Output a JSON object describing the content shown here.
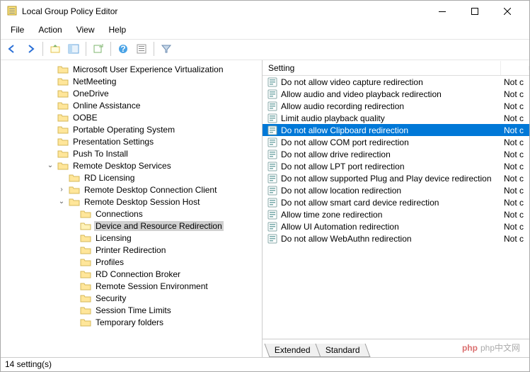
{
  "window": {
    "title": "Local Group Policy Editor"
  },
  "menu": {
    "file": "File",
    "action": "Action",
    "view": "View",
    "help": "Help"
  },
  "tree": [
    {
      "indent": 4,
      "exp": "",
      "label": "Microsoft User Experience Virtualization"
    },
    {
      "indent": 4,
      "exp": "",
      "label": "NetMeeting"
    },
    {
      "indent": 4,
      "exp": "",
      "label": "OneDrive"
    },
    {
      "indent": 4,
      "exp": "",
      "label": "Online Assistance"
    },
    {
      "indent": 4,
      "exp": "",
      "label": "OOBE"
    },
    {
      "indent": 4,
      "exp": "",
      "label": "Portable Operating System"
    },
    {
      "indent": 4,
      "exp": "",
      "label": "Presentation Settings"
    },
    {
      "indent": 4,
      "exp": "",
      "label": "Push To Install"
    },
    {
      "indent": 4,
      "exp": "⌄",
      "label": "Remote Desktop Services"
    },
    {
      "indent": 5,
      "exp": "",
      "label": "RD Licensing"
    },
    {
      "indent": 5,
      "exp": "›",
      "label": "Remote Desktop Connection Client"
    },
    {
      "indent": 5,
      "exp": "⌄",
      "label": "Remote Desktop Session Host"
    },
    {
      "indent": 6,
      "exp": "",
      "label": "Connections"
    },
    {
      "indent": 6,
      "exp": "",
      "label": "Device and Resource Redirection",
      "selected": true
    },
    {
      "indent": 6,
      "exp": "",
      "label": "Licensing"
    },
    {
      "indent": 6,
      "exp": "",
      "label": "Printer Redirection"
    },
    {
      "indent": 6,
      "exp": "",
      "label": "Profiles"
    },
    {
      "indent": 6,
      "exp": "",
      "label": "RD Connection Broker"
    },
    {
      "indent": 6,
      "exp": "",
      "label": "Remote Session Environment"
    },
    {
      "indent": 6,
      "exp": "",
      "label": "Security"
    },
    {
      "indent": 6,
      "exp": "",
      "label": "Session Time Limits"
    },
    {
      "indent": 6,
      "exp": "",
      "label": "Temporary folders"
    }
  ],
  "list": {
    "header": {
      "setting": "Setting",
      "state": ""
    },
    "items": [
      {
        "label": "Do not allow video capture redirection",
        "state": "Not c"
      },
      {
        "label": "Allow audio and video playback redirection",
        "state": "Not c"
      },
      {
        "label": "Allow audio recording redirection",
        "state": "Not c"
      },
      {
        "label": "Limit audio playback quality",
        "state": "Not c"
      },
      {
        "label": "Do not allow Clipboard redirection",
        "state": "Not c",
        "selected": true
      },
      {
        "label": "Do not allow COM port redirection",
        "state": "Not c"
      },
      {
        "label": "Do not allow drive redirection",
        "state": "Not c"
      },
      {
        "label": "Do not allow LPT port redirection",
        "state": "Not c"
      },
      {
        "label": "Do not allow supported Plug and Play device redirection",
        "state": "Not c"
      },
      {
        "label": "Do not allow location redirection",
        "state": "Not c"
      },
      {
        "label": "Do not allow smart card device redirection",
        "state": "Not c"
      },
      {
        "label": "Allow time zone redirection",
        "state": "Not c"
      },
      {
        "label": "Allow UI Automation redirection",
        "state": "Not c"
      },
      {
        "label": "Do not allow WebAuthn redirection",
        "state": "Not c"
      }
    ]
  },
  "tabs": {
    "extended": "Extended",
    "standard": "Standard"
  },
  "status": "14 setting(s)",
  "watermark": "php中文网"
}
